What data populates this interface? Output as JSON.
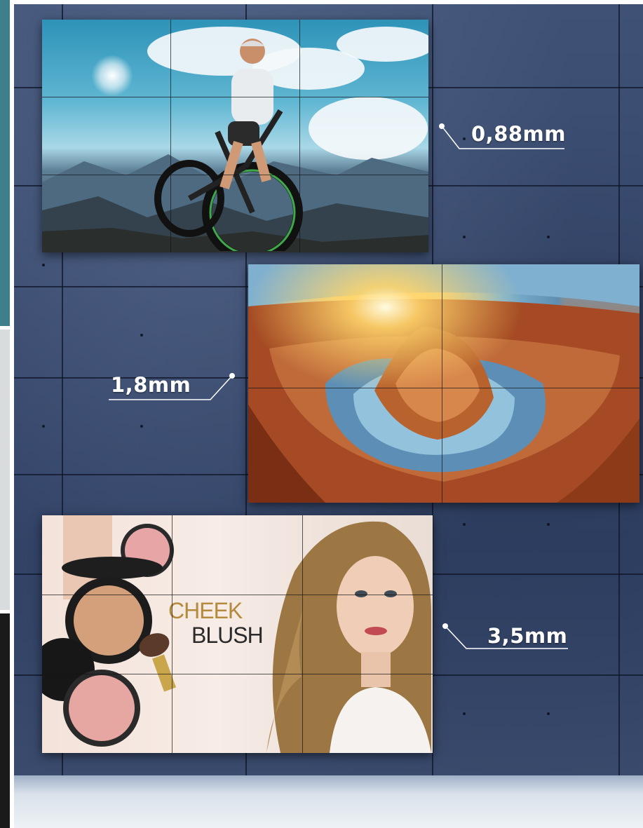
{
  "scene": {
    "bezel_labels": [
      {
        "id": "top",
        "text": "0,88mm"
      },
      {
        "id": "middle",
        "text": "1,8mm"
      },
      {
        "id": "bottom",
        "text": "3,5mm"
      }
    ],
    "blush_ad": {
      "line1": "CHEEK",
      "line2": "BLUSH"
    },
    "colors": {
      "wall": "#3a4b6d",
      "label_text": "#ffffff",
      "left_strip_top": "#3f7f8c",
      "left_strip_middle": "#d9dcdf",
      "left_strip_bottom": "#1a1a1a"
    }
  }
}
